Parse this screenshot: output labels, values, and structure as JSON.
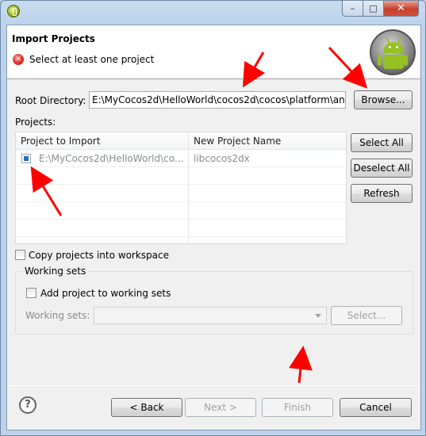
{
  "window": {
    "title": ""
  },
  "header": {
    "title": "Import Projects",
    "message": "Select at least one project"
  },
  "root": {
    "label": "Root Directory:",
    "value": "E:\\MyCocos2d\\HelloWorld\\cocos2d\\cocos\\platform\\an",
    "browse_label": "Browse..."
  },
  "projects": {
    "label": "Projects:",
    "columns": [
      "Project to Import",
      "New Project Name"
    ],
    "rows": [
      {
        "path": "E:\\MyCocos2d\\HelloWorld\\co...",
        "name": "libcocos2dx",
        "checked": true
      }
    ],
    "select_all": "Select All",
    "deselect_all": "Deselect All",
    "refresh": "Refresh"
  },
  "copy_label": "Copy projects into workspace",
  "working_sets": {
    "group_label": "Working sets",
    "add_label": "Add project to working sets",
    "sets_label": "Working sets:",
    "select_label": "Select..."
  },
  "footer": {
    "back": "< Back",
    "next": "Next >",
    "finish": "Finish",
    "cancel": "Cancel"
  },
  "colors": {
    "annotation_arrow": "#ff0000",
    "error": "#d0201a",
    "android_green": "#97c024"
  }
}
